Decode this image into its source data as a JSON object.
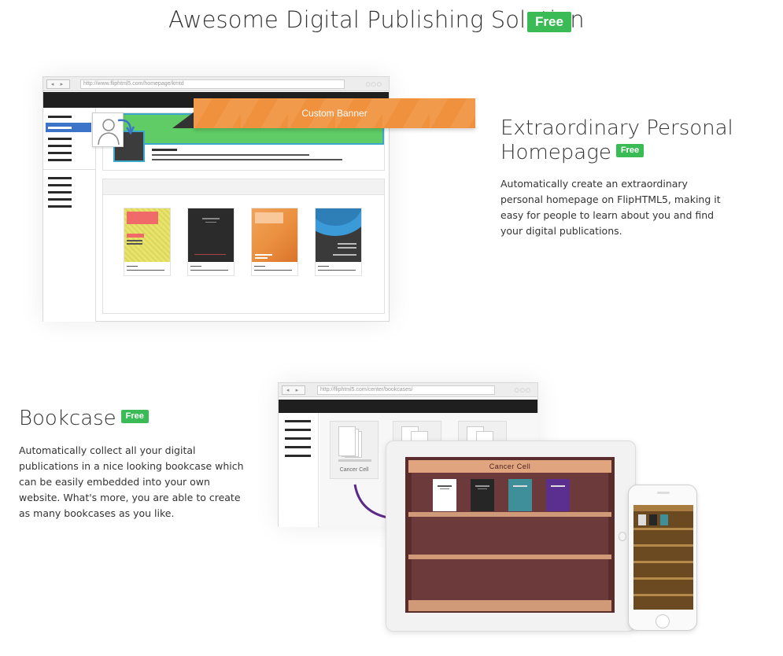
{
  "header": {
    "title": "Awesome Digital Publishing Solution",
    "badge": "Free"
  },
  "homepage_section": {
    "title_line1": "Extraordinary Personal",
    "title_line2": "Homepage",
    "badge": "Free",
    "description": "Automatically create an extraordinary personal homepage on FlipHTML5, making it easy for people to learn about you and find your digital publications.",
    "mockup": {
      "nav_buttons": "◂ ▸",
      "url": "http://www.fliphtml5.com/homepage/kmtd",
      "banner_label": "Custom Banner",
      "book_colors": [
        "#e8e36a",
        "#2b2b2b",
        "#ea8f3e",
        "#3a3a3a"
      ]
    }
  },
  "bookcase_section": {
    "title": "Bookcase",
    "badge": "Free",
    "description": "Automatically collect all your digital publications in a nice looking bookcase which can be easily embedded into your own website. What's more, you are able to create as many bookcases as you like.",
    "mockup": {
      "nav_buttons": "◂ ▸",
      "url": "http://fliphtml5.com/center/bookcases/",
      "card_label": "Cancer Cell",
      "shelf_title": "Cancer Cell",
      "book_colors": [
        "#ffffff",
        "#262626",
        "#3f8f9a",
        "#5a2f8f"
      ],
      "arrow_color": "#5b2a86"
    }
  }
}
